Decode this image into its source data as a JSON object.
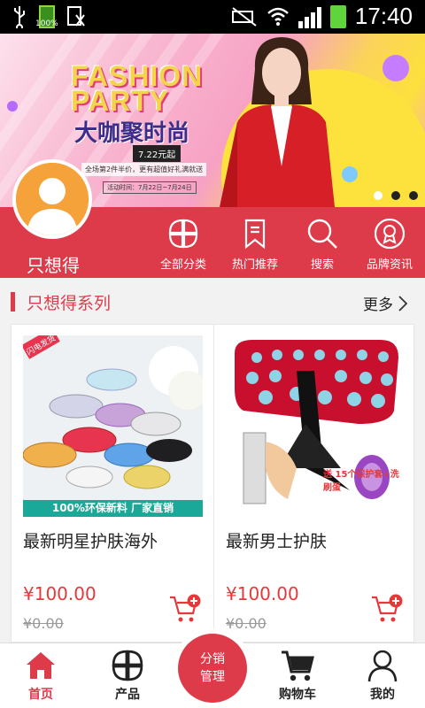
{
  "status_bar": {
    "battery_small": "100%",
    "time": "17:40"
  },
  "banner": {
    "headline_en_1": "FASHION",
    "headline_en_2": "PARTY",
    "headline_cn": "大咖聚时尚",
    "date_tag": "7.22元起",
    "promo_line": "全场第2件半价，更有超值好礼满就送",
    "promo_date": "活动时间：7月22日~7月24日",
    "slides": 3,
    "active_slide": 1
  },
  "profile": {
    "name": "只想得"
  },
  "header_nav": [
    {
      "label": "全部分类",
      "icon": "grid-icon"
    },
    {
      "label": "热门推荐",
      "icon": "bookmark-icon"
    },
    {
      "label": "搜索",
      "icon": "search-icon"
    },
    {
      "label": "品牌资讯",
      "icon": "award-icon"
    }
  ],
  "section": {
    "title": "只想得系列",
    "more": "更多"
  },
  "products": [
    {
      "title": "最新明星护肤海外",
      "price": "¥100.00",
      "old_price": "¥0.00",
      "img_badge": "闪电发货",
      "img_caption": "100%环保新料  厂家直销"
    },
    {
      "title": "最新男士护肤",
      "price": "¥100.00",
      "old_price": "¥0.00",
      "img_caption": "送 15个保护套+洗刷蛋"
    }
  ],
  "bottom_nav": [
    {
      "label": "首页",
      "icon": "home-icon",
      "active": true
    },
    {
      "label": "产品",
      "icon": "grid-icon"
    },
    {
      "label": "购物车",
      "icon": "cart-icon"
    },
    {
      "label": "我的",
      "icon": "user-icon"
    }
  ],
  "fab": {
    "line1": "分销",
    "line2": "管理"
  },
  "colors": {
    "brand_red": "#de3b4a",
    "price_red": "#e5383b"
  }
}
